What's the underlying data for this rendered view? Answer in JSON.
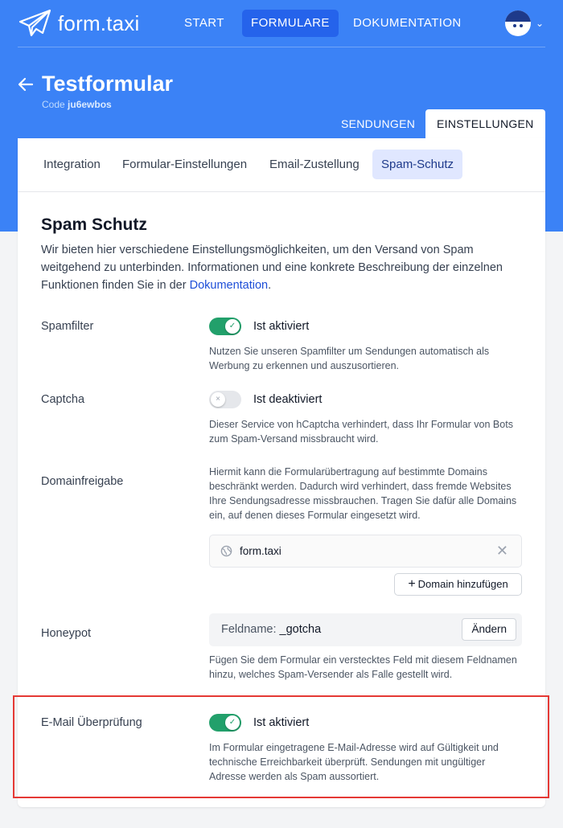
{
  "nav": {
    "brand": "form.taxi",
    "links": [
      "START",
      "FORMULARE",
      "DOKUMENTATION"
    ],
    "active_link": "FORMULARE"
  },
  "header": {
    "title": "Testformular",
    "code_label": "Code",
    "code_value": "ju6ewbos"
  },
  "page_tabs": [
    "SENDUNGEN",
    "EINSTELLUNGEN"
  ],
  "sub_tabs": [
    "Integration",
    "Formular-Einstellungen",
    "Email-Zustellung",
    "Spam-Schutz"
  ],
  "section": {
    "title": "Spam Schutz",
    "intro": "Wir bieten hier verschiedene Einstellungsmöglichkeiten, um den Versand von Spam weitgehend zu unterbinden. Informationen und eine konkrete Beschreibung der einzelnen Funktionen finden Sie in der ",
    "intro_link": "Dokumentation",
    "intro_end": "."
  },
  "settings": {
    "spamfilter": {
      "label": "Spamfilter",
      "status": "Ist aktiviert",
      "enabled": true,
      "desc": "Nutzen Sie unseren Spamfilter um Sendungen automatisch als Werbung zu erkennen und auszusortieren."
    },
    "captcha": {
      "label": "Captcha",
      "status": "Ist deaktiviert",
      "enabled": false,
      "desc": "Dieser Service von hCaptcha verhindert, dass Ihr Formular von Bots zum Spam-Versand missbraucht wird."
    },
    "domain": {
      "label": "Domainfreigabe",
      "desc": "Hiermit kann die Formularübertragung auf bestimmte Domains beschränkt werden. Dadurch wird verhindert, dass fremde Websites Ihre Sendungsadresse missbrauchen. Tragen Sie dafür alle Domains ein, auf denen dieses Formular eingesetzt wird.",
      "entry": "form.taxi",
      "add_button": "Domain hinzufügen"
    },
    "honeypot": {
      "label": "Honeypot",
      "field_label": "Feldname:",
      "field_value": "_gotcha",
      "change_button": "Ändern",
      "desc": "Fügen Sie dem Formular ein verstecktes Feld mit diesem Feldnamen hinzu, welches Spam-Versender als Falle gestellt wird."
    },
    "email_check": {
      "label": "E-Mail Überprüfung",
      "status": "Ist aktiviert",
      "enabled": true,
      "desc": "Im Formular eingetragene E-Mail-Adresse wird auf Gültigkeit und technische Erreichbarkeit überprüft. Sendungen mit ungültiger Adresse werden als Spam aussortiert."
    }
  },
  "colors": {
    "brand_blue": "#3b82f6",
    "toggle_on": "#22a06b",
    "highlight": "#e53935"
  }
}
